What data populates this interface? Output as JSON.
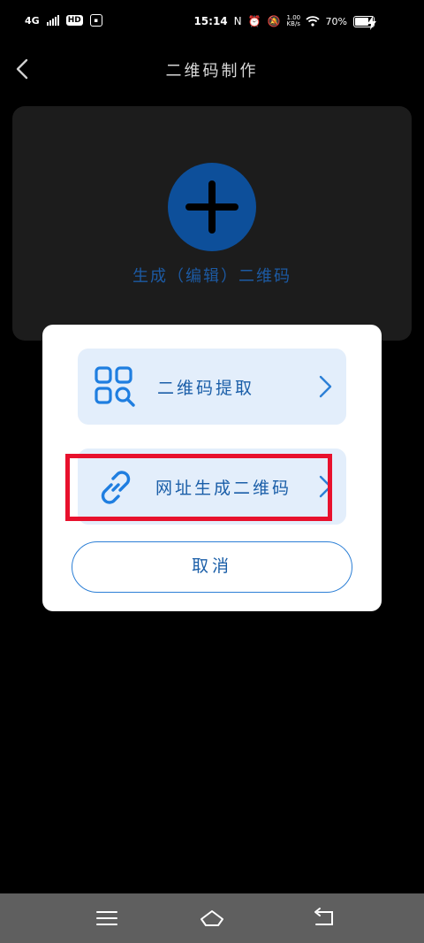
{
  "status_bar": {
    "network": "4G",
    "hd": "HD",
    "time": "15:14",
    "net_speed_value": "1.00",
    "net_speed_unit": "KB/s",
    "battery_percent": "70%"
  },
  "header": {
    "title": "二维码制作"
  },
  "card": {
    "label": "生成（编辑）二维码"
  },
  "dialog": {
    "options": [
      {
        "label": "二维码提取",
        "icon": "qr-scan-icon"
      },
      {
        "label": "网址生成二维码",
        "icon": "link-icon"
      }
    ],
    "cancel_label": "取消"
  },
  "nav": {
    "buttons": [
      "menu-icon",
      "home-icon",
      "back-icon"
    ]
  },
  "colors": {
    "accent": "#1a5ea8",
    "highlight": "#e8112d",
    "option_bg": "#e3eefb",
    "navbar_bg": "#5f5f5f"
  }
}
